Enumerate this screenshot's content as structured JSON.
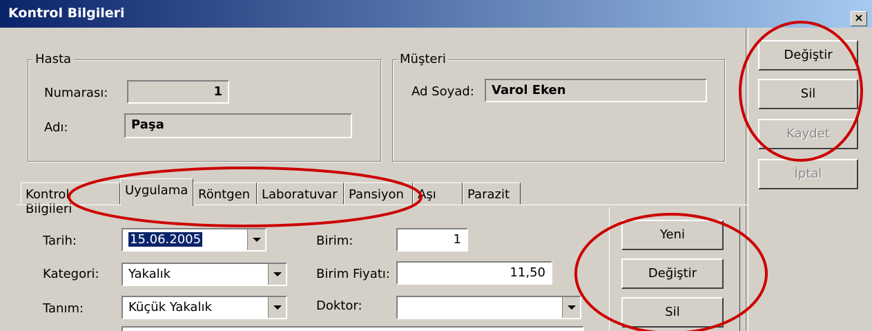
{
  "window": {
    "title": "Kontrol Bilgileri",
    "close_label": "×"
  },
  "right_actions": {
    "edit": "Değiştir",
    "delete": "Sil",
    "save": "Kaydet",
    "cancel": "İptal"
  },
  "hasta": {
    "legend": "Hasta",
    "numara_label": "Numarası:",
    "numara_value": "1",
    "adi_label": "Adı:",
    "adi_value": "Paşa"
  },
  "musteri": {
    "legend": "Müşteri",
    "adsoyad_label": "Ad Soyad:",
    "adsoyad_value": "Varol Eken"
  },
  "tabs": [
    "Kontrol Bilgileri",
    "Uygulama",
    "Röntgen",
    "Laboratuvar",
    "Pansiyon",
    "Aşı",
    "Parazit"
  ],
  "active_tab": "Uygulama",
  "uygulama": {
    "tarih_label": "Tarih:",
    "tarih_value": "15.06.2005",
    "kategori_label": "Kategori:",
    "kategori_value": "Yakalık",
    "tanim_label": "Tanım:",
    "tanim_value": "Küçük Yakalık",
    "birim_label": "Birim:",
    "birim_value": "1",
    "birim_fiyati_label": "Birim Fiyatı:",
    "birim_fiyati_value": "11,50",
    "doktor_label": "Doktor:",
    "doktor_value": ""
  },
  "inner_actions": {
    "new": "Yeni",
    "edit": "Değiştir",
    "delete": "Sil"
  },
  "colors": {
    "title_bar": "#0a246a",
    "annotation": "#cc0000",
    "dialog_bg": "#d4d0c8"
  }
}
